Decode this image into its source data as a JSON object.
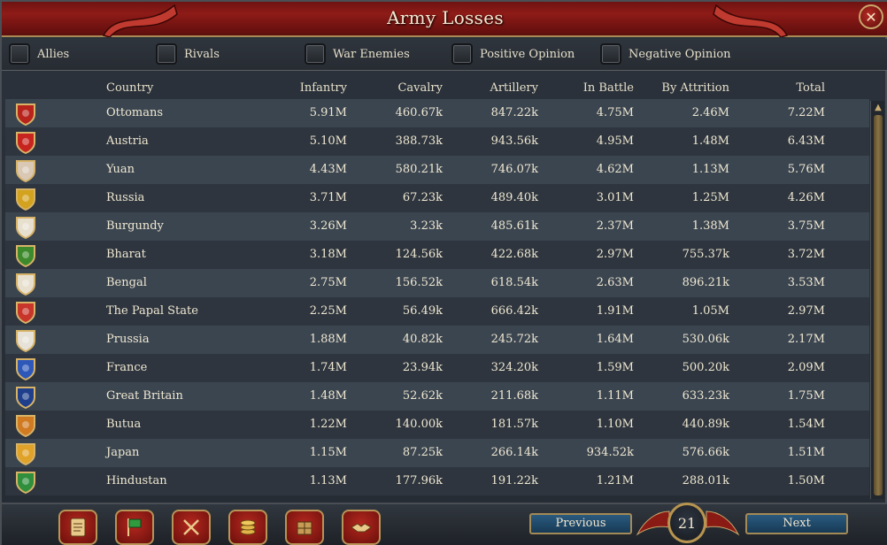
{
  "window": {
    "title": "Army Losses",
    "close_icon": "close-icon"
  },
  "filters": [
    {
      "label": "Allies",
      "checked": false
    },
    {
      "label": "Rivals",
      "checked": false
    },
    {
      "label": "War Enemies",
      "checked": false
    },
    {
      "label": "Positive Opinion",
      "checked": false
    },
    {
      "label": "Negative Opinion",
      "checked": false
    }
  ],
  "columns": {
    "country": "Country",
    "infantry": "Infantry",
    "cavalry": "Cavalry",
    "artillery": "Artillery",
    "in_battle": "In Battle",
    "by_attrition": "By Attrition",
    "total": "Total"
  },
  "rows": [
    {
      "country": "Ottomans",
      "flag": "crescent-shield-icon",
      "color": "#b8231c",
      "infantry": "5.91M",
      "cavalry": "460.67k",
      "artillery": "847.22k",
      "in_battle": "4.75M",
      "by_attrition": "2.46M",
      "total": "7.22M"
    },
    {
      "country": "Austria",
      "flag": "bar-shield-icon",
      "color": "#c8241f",
      "infantry": "5.10M",
      "cavalry": "388.73k",
      "artillery": "943.56k",
      "in_battle": "4.95M",
      "by_attrition": "1.48M",
      "total": "6.43M"
    },
    {
      "country": "Yuan",
      "flag": "circle-shield-icon",
      "color": "#d8c8b4",
      "infantry": "4.43M",
      "cavalry": "580.21k",
      "artillery": "746.07k",
      "in_battle": "4.62M",
      "by_attrition": "1.13M",
      "total": "5.76M"
    },
    {
      "country": "Russia",
      "flag": "eagle-shield-icon",
      "color": "#d3a21e",
      "infantry": "3.71M",
      "cavalry": "67.23k",
      "artillery": "489.40k",
      "in_battle": "3.01M",
      "by_attrition": "1.25M",
      "total": "4.26M"
    },
    {
      "country": "Burgundy",
      "flag": "saltire-shield-icon",
      "color": "#e8e0cf",
      "infantry": "3.26M",
      "cavalry": "3.23k",
      "artillery": "485.61k",
      "in_battle": "2.37M",
      "by_attrition": "1.38M",
      "total": "3.75M"
    },
    {
      "country": "Bharat",
      "flag": "emblem-shield-icon",
      "color": "#3d8a2c",
      "infantry": "3.18M",
      "cavalry": "124.56k",
      "artillery": "422.68k",
      "in_battle": "2.97M",
      "by_attrition": "755.37k",
      "total": "3.72M"
    },
    {
      "country": "Bengal",
      "flag": "flower-shield-icon",
      "color": "#e8e0cf",
      "infantry": "2.75M",
      "cavalry": "156.52k",
      "artillery": "618.54k",
      "in_battle": "2.63M",
      "by_attrition": "896.21k",
      "total": "3.53M"
    },
    {
      "country": "The Papal State",
      "flag": "keys-shield-icon",
      "color": "#c8352a",
      "infantry": "2.25M",
      "cavalry": "56.49k",
      "artillery": "666.42k",
      "in_battle": "1.91M",
      "by_attrition": "1.05M",
      "total": "2.97M"
    },
    {
      "country": "Prussia",
      "flag": "black-eagle-shield-icon",
      "color": "#e6e2d8",
      "infantry": "1.88M",
      "cavalry": "40.82k",
      "artillery": "245.72k",
      "in_battle": "1.64M",
      "by_attrition": "530.06k",
      "total": "2.17M"
    },
    {
      "country": "France",
      "flag": "fleur-shield-icon",
      "color": "#2d57b8",
      "infantry": "1.74M",
      "cavalry": "23.94k",
      "artillery": "324.20k",
      "in_battle": "1.59M",
      "by_attrition": "500.20k",
      "total": "2.09M"
    },
    {
      "country": "Great Britain",
      "flag": "union-shield-icon",
      "color": "#1f3f8c",
      "infantry": "1.48M",
      "cavalry": "52.62k",
      "artillery": "211.68k",
      "in_battle": "1.11M",
      "by_attrition": "633.23k",
      "total": "1.75M"
    },
    {
      "country": "Butua",
      "flag": "lion-shield-icon",
      "color": "#d07a22",
      "infantry": "1.22M",
      "cavalry": "140.00k",
      "artillery": "181.57k",
      "in_battle": "1.10M",
      "by_attrition": "440.89k",
      "total": "1.54M"
    },
    {
      "country": "Japan",
      "flag": "mon-shield-icon",
      "color": "#e0a228",
      "infantry": "1.15M",
      "cavalry": "87.25k",
      "artillery": "266.14k",
      "in_battle": "934.52k",
      "by_attrition": "576.66k",
      "total": "1.51M"
    },
    {
      "country": "Hindustan",
      "flag": "crescent-green-shield-icon",
      "color": "#2f8f3c",
      "infantry": "1.13M",
      "cavalry": "177.96k",
      "artillery": "191.22k",
      "in_battle": "1.21M",
      "by_attrition": "288.01k",
      "total": "1.50M"
    }
  ],
  "bottom": {
    "tabs": [
      {
        "name": "ledger-tab",
        "icon": "document-icon"
      },
      {
        "name": "flags-tab",
        "icon": "flag-icon"
      },
      {
        "name": "war-tab",
        "icon": "crossed-swords-icon"
      },
      {
        "name": "treasury-tab",
        "icon": "coins-icon"
      },
      {
        "name": "trade-tab",
        "icon": "crate-icon"
      },
      {
        "name": "diplomacy-tab",
        "icon": "handshake-icon"
      }
    ],
    "previous_label": "Previous",
    "next_label": "Next",
    "page_number": "21"
  },
  "colors": {
    "title_bar": "#8e1b17",
    "row_odd": "#3b4550",
    "row_even": "#2e353e",
    "gold_trim": "#b7944f",
    "nav_button": "#2a5a7e"
  }
}
